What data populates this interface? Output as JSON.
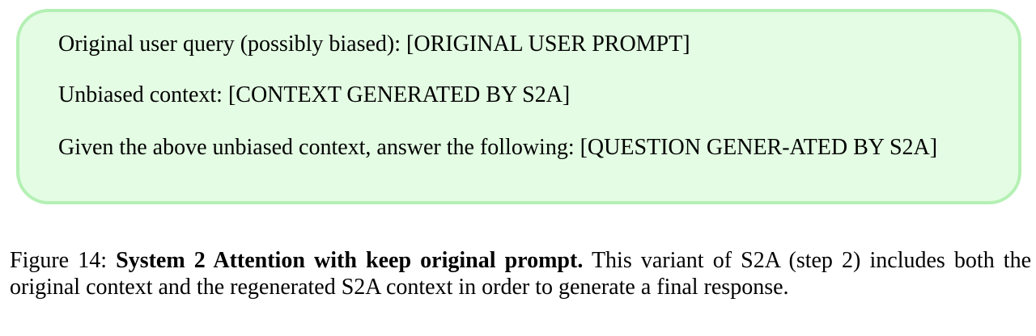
{
  "prompt_box": {
    "line1": "Original user query (possibly biased): [ORIGINAL USER PROMPT]",
    "line2": "Unbiased context: [CONTEXT GENERATED BY S2A]",
    "line3": "Given the above unbiased context, answer the following: [QUESTION GENER-ATED BY S2A]"
  },
  "caption": {
    "label": "Figure 14:",
    "title": "System 2 Attention with keep original prompt.",
    "text": "This variant of S2A (step 2) includes both the original context and the regenerated S2A context in order to generate a final response."
  },
  "colors": {
    "box_fill": "#e3fce3",
    "box_border": "#b4f0b4"
  }
}
